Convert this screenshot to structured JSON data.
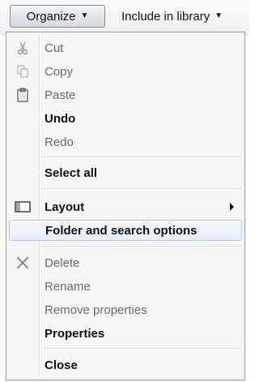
{
  "toolbar": {
    "organize_label": "Organize",
    "include_label": "Include in library"
  },
  "menu": {
    "cut": "Cut",
    "copy": "Copy",
    "paste": "Paste",
    "undo": "Undo",
    "redo": "Redo",
    "select_all": "Select all",
    "layout": "Layout",
    "folder_options": "Folder and search options",
    "delete": "Delete",
    "rename": "Rename",
    "remove_properties": "Remove properties",
    "properties": "Properties",
    "close": "Close"
  }
}
